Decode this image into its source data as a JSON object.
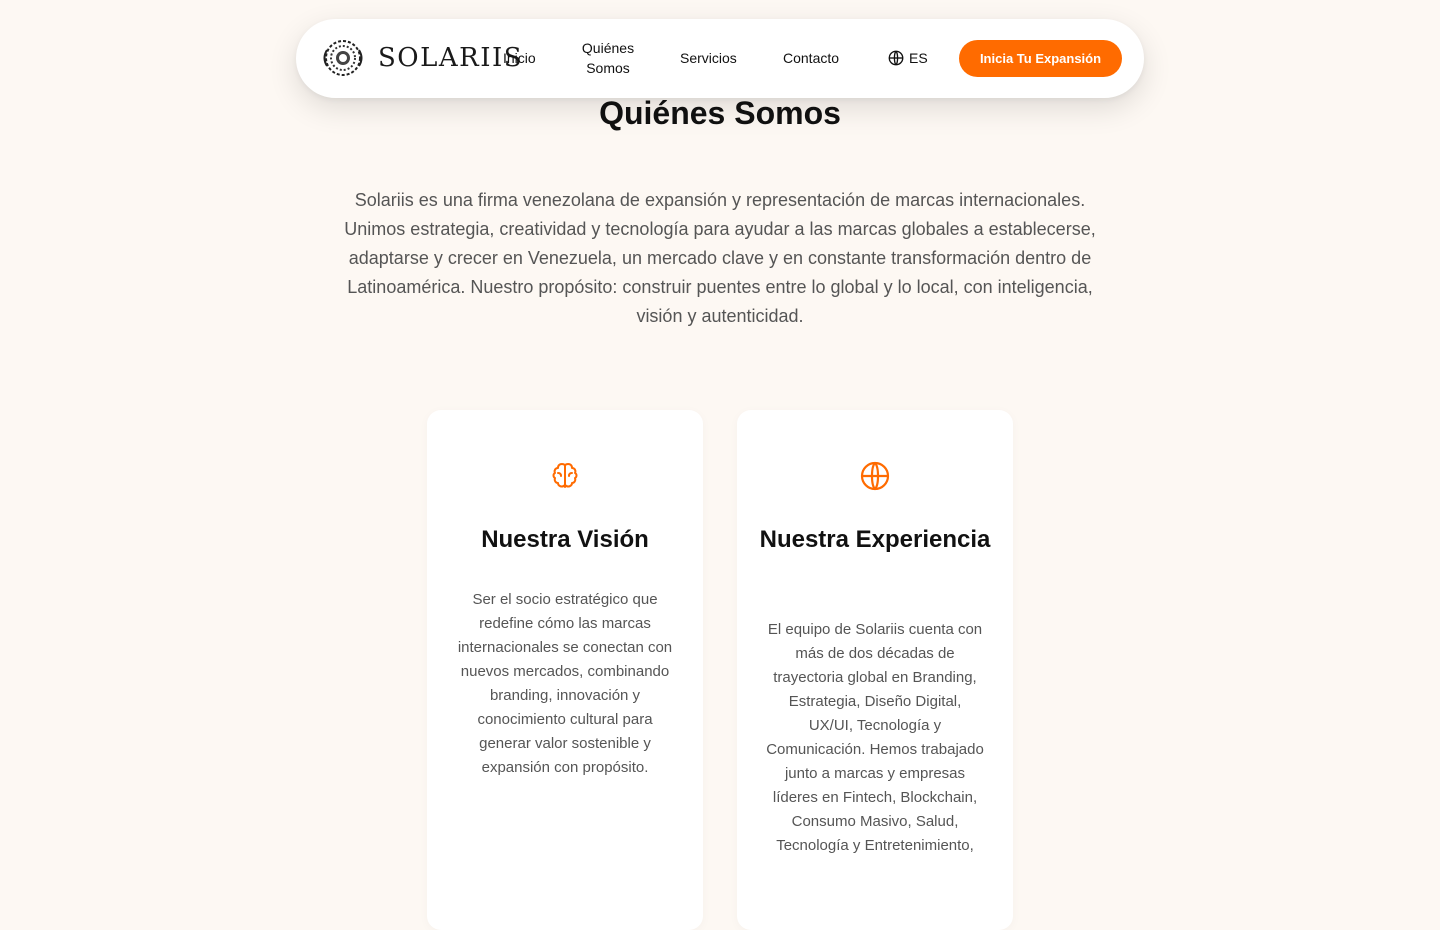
{
  "nav": {
    "brand": "SOLARIIS",
    "items": [
      {
        "label": "Inicio"
      },
      {
        "label": "Quiénes Somos"
      },
      {
        "label": "Servicios"
      },
      {
        "label": "Contacto"
      }
    ],
    "language": "ES",
    "cta": "Inicia Tu Expansión",
    "accent_color": "#ff6b00"
  },
  "about": {
    "title": "Quiénes Somos",
    "intro": "Solariis es una firma venezolana de expansión y representación de marcas internacionales. Unimos estrategia, creatividad y tecnología para ayudar a las marcas globales a establecerse, adaptarse y crecer en Venezuela, un mercado clave y en constante transformación dentro de Latinoamérica. Nuestro propósito: construir puentes entre lo global y lo local, con inteligencia, visión y autenticidad."
  },
  "cards": [
    {
      "icon": "brain-icon",
      "title": "Nuestra Visión",
      "text": "Ser el socio estratégico que redefine cómo las marcas internacionales se conectan con nuevos mercados, combinando branding, innovación y conocimiento cultural para generar valor sostenible y expansión con propósito."
    },
    {
      "icon": "globe-icon",
      "title": "Nuestra Experiencia",
      "text": "El equipo de Solariis cuenta con más de dos décadas de trayectoria global en Branding, Estrategia, Diseño Digital, UX/UI, Tecnología y Comunicación. Hemos trabajado junto a marcas y empresas líderes en Fintech, Blockchain, Consumo Masivo, Salud, Tecnología y Entretenimiento,"
    }
  ]
}
